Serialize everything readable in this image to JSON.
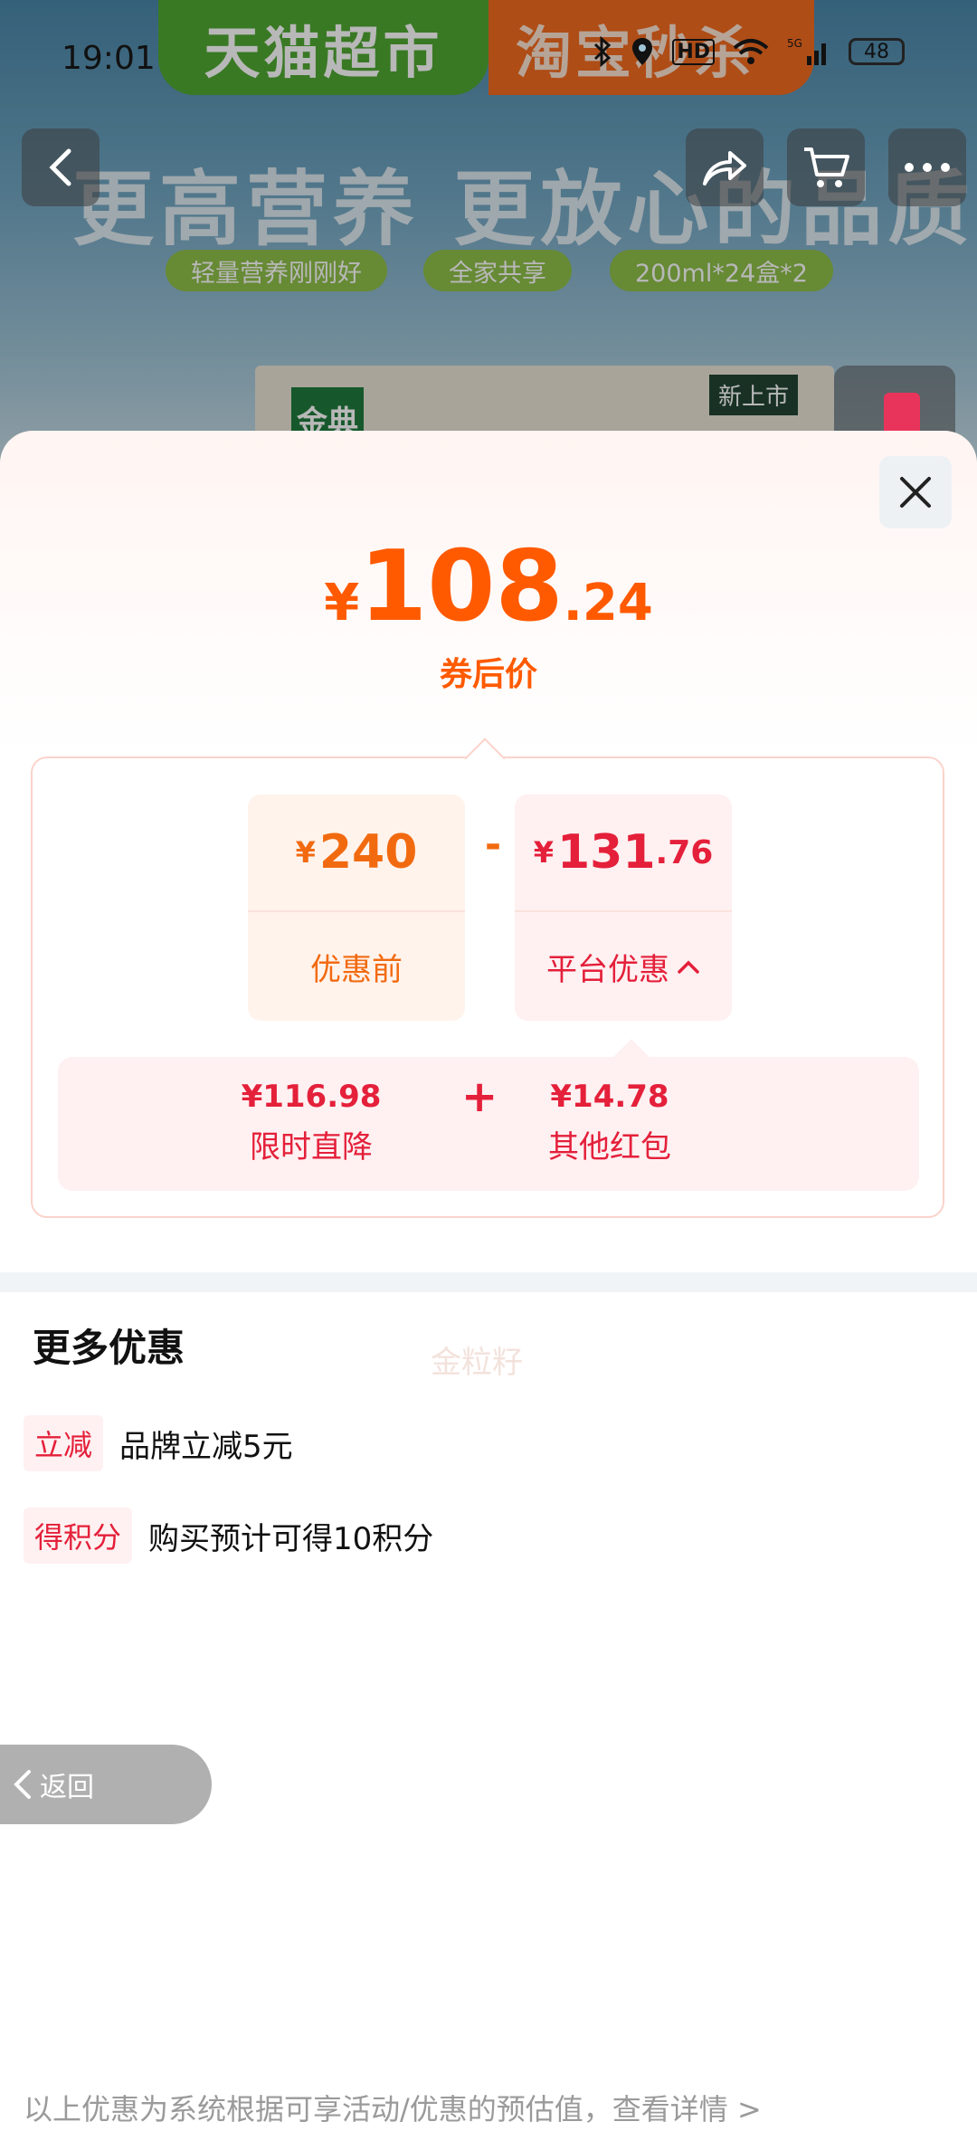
{
  "status_bar": {
    "time": "19:01",
    "icons": [
      "bluetooth-icon",
      "location-icon",
      "hd-icon",
      "wifi-icon",
      "signal-5g-icon"
    ],
    "battery": "48"
  },
  "banner": {
    "tab_primary": "天猫超市",
    "tab_secondary": "淘宝秒杀",
    "slogan": "更高营养 更放心的品质",
    "chips": [
      "轻量营养刚刚好",
      "全家共享",
      "200ml*24盒*2"
    ],
    "product_logo": "金典",
    "product_badge": "新上市"
  },
  "nav": {
    "back": "‹",
    "share": "↗",
    "cart": "🛒",
    "more": "•••"
  },
  "sheet": {
    "price": {
      "currency": "¥",
      "integer": "108",
      "decimal": ".24",
      "label": "券后价"
    },
    "before": {
      "currency": "¥",
      "integer": "240",
      "decimal": "",
      "label": "优惠前"
    },
    "operator": "-",
    "platform": {
      "currency": "¥",
      "integer": "131",
      "decimal": ".76",
      "label": "平台优惠",
      "caret": "^"
    },
    "sub_items": [
      {
        "value": "¥116.98",
        "label": "限时直降"
      },
      {
        "value": "¥14.78",
        "label": "其他红包"
      }
    ],
    "plus": "+",
    "watermark": "金粒籽"
  },
  "more_promos": {
    "title": "更多优惠",
    "items": [
      {
        "tag": "立减",
        "text": "品牌立减5元"
      },
      {
        "tag": "得积分",
        "text": "购买预计可得10积分"
      }
    ]
  },
  "back_button": {
    "label": "返回"
  },
  "footer": {
    "note": "以上优惠为系统根据可享活动/优惠的预估值，查看详情 >"
  }
}
